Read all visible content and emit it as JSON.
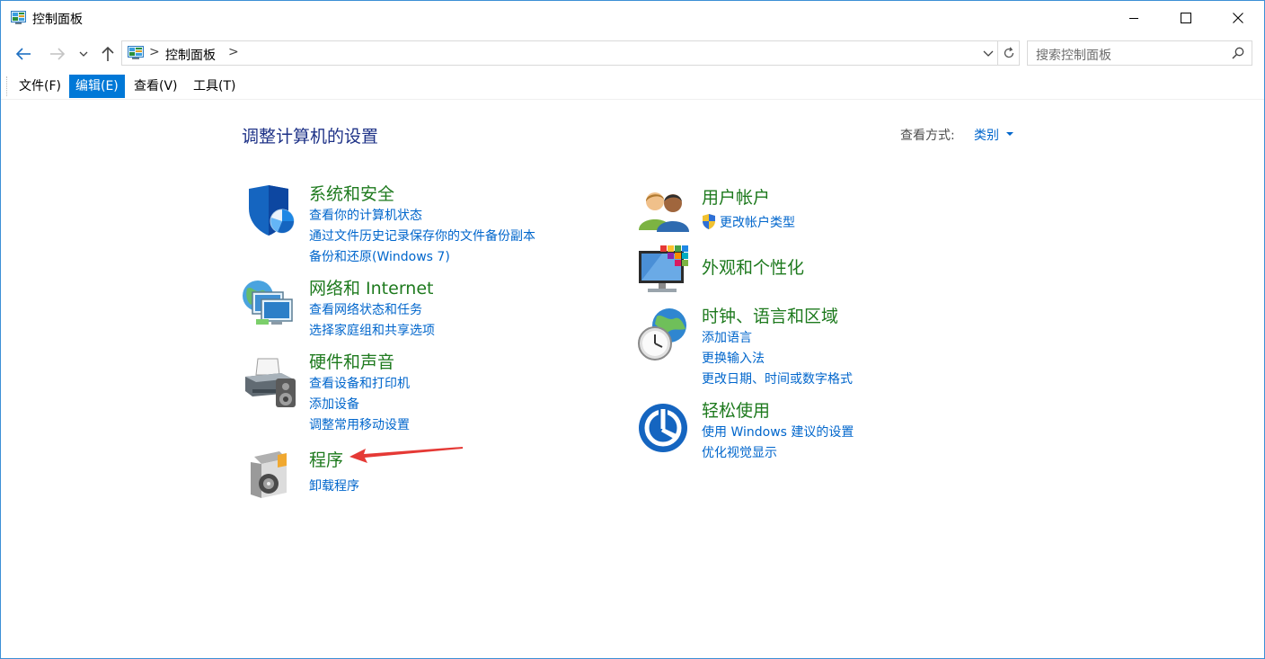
{
  "window": {
    "title": "控制面板",
    "minimize_icon": "minimize-icon",
    "maximize_icon": "maximize-icon",
    "close_icon": "close-icon"
  },
  "navigation": {
    "back_icon": "back-arrow-icon",
    "forward_icon": "forward-arrow-icon",
    "recent_icon": "chevron-down-icon",
    "up_icon": "up-arrow-icon",
    "address_crumb": "控制面板",
    "address_separator": ">",
    "search_placeholder": "搜索控制面板"
  },
  "menu": {
    "items": [
      {
        "label": "文件(F)",
        "active": false
      },
      {
        "label": "编辑(E)",
        "active": true
      },
      {
        "label": "查看(V)",
        "active": false
      },
      {
        "label": "工具(T)",
        "active": false
      }
    ]
  },
  "content": {
    "title": "调整计算机的设置",
    "viewby_label": "查看方式:",
    "viewby_value": "类别"
  },
  "categories": {
    "system_security": {
      "title": "系统和安全",
      "icon": "shield-icon",
      "links": [
        "查看你的计算机状态",
        "通过文件历史记录保存你的文件备份副本",
        "备份和还原(Windows 7)"
      ]
    },
    "network": {
      "title": "网络和 Internet",
      "icon": "network-icon",
      "links": [
        "查看网络状态和任务",
        "选择家庭组和共享选项"
      ]
    },
    "hardware": {
      "title": "硬件和声音",
      "icon": "printer-icon",
      "links": [
        "查看设备和打印机",
        "添加设备",
        "调整常用移动设置"
      ]
    },
    "programs": {
      "title": "程序",
      "icon": "programs-icon",
      "links": [
        "卸载程序"
      ]
    },
    "user_accounts": {
      "title": "用户帐户",
      "icon": "users-icon",
      "links": [
        "更改帐户类型"
      ]
    },
    "appearance": {
      "title": "外观和个性化",
      "icon": "monitor-icon",
      "links": []
    },
    "clock_region": {
      "title": "时钟、语言和区域",
      "icon": "clock-globe-icon",
      "links": [
        "添加语言",
        "更换输入法",
        "更改日期、时间或数字格式"
      ]
    },
    "ease_access": {
      "title": "轻松使用",
      "icon": "ease-of-access-icon",
      "links": [
        "使用 Windows 建议的设置",
        "优化视觉显示"
      ]
    }
  },
  "colors": {
    "accent": "#0078d7",
    "link": "#0066cc",
    "category_title": "#1e7a1e",
    "page_title": "#1e3287",
    "annotation_arrow": "#e53935"
  }
}
